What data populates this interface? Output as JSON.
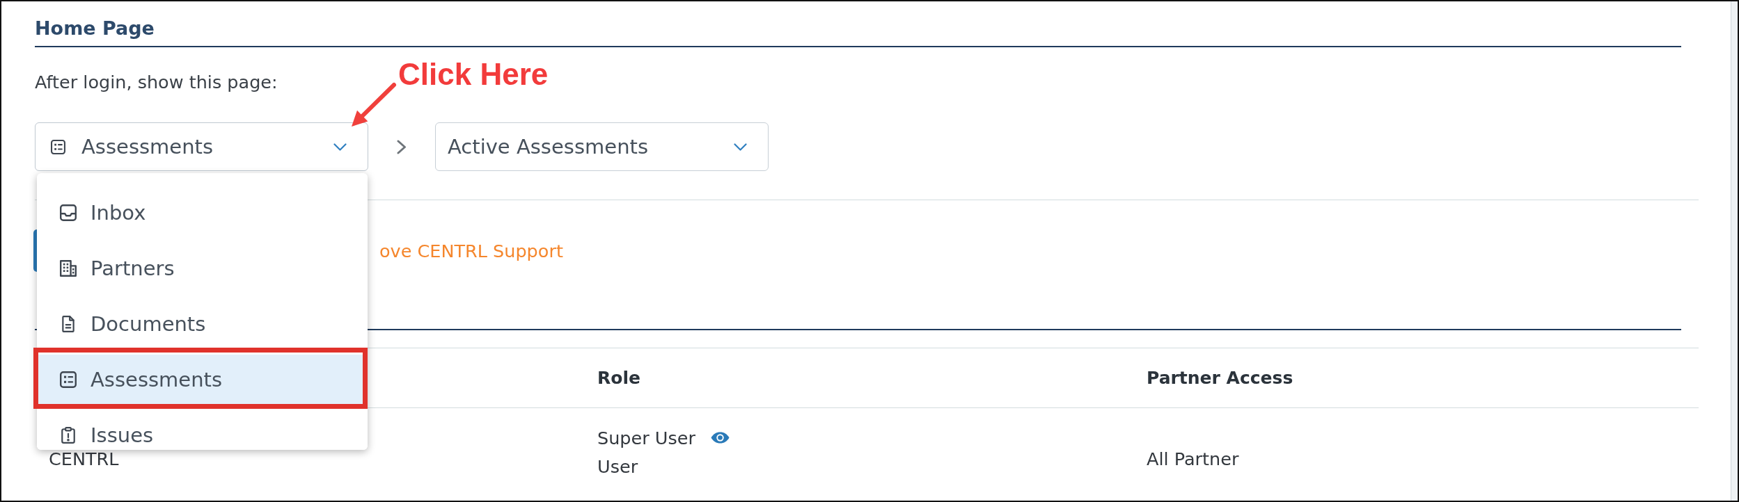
{
  "section": {
    "title": "Home Page",
    "prompt": "After login, show this page:"
  },
  "page_select": {
    "value": "Assessments",
    "expanded": true,
    "options": [
      {
        "label": "Inbox",
        "selected": false
      },
      {
        "label": "Partners",
        "selected": false
      },
      {
        "label": "Documents",
        "selected": false
      },
      {
        "label": "Assessments",
        "selected": true
      },
      {
        "label": "Issues",
        "selected": false
      }
    ]
  },
  "subpage_select": {
    "value": "Active Assessments"
  },
  "annotation": {
    "text": "Click Here"
  },
  "support_link": {
    "label": "ove CENTRL Support"
  },
  "table": {
    "columns": [
      "Role",
      "Partner Access"
    ],
    "rows": [
      {
        "column_1": "CENTRL",
        "roles": [
          "Super User",
          "User"
        ],
        "partner_access": "All Partner"
      }
    ]
  }
}
